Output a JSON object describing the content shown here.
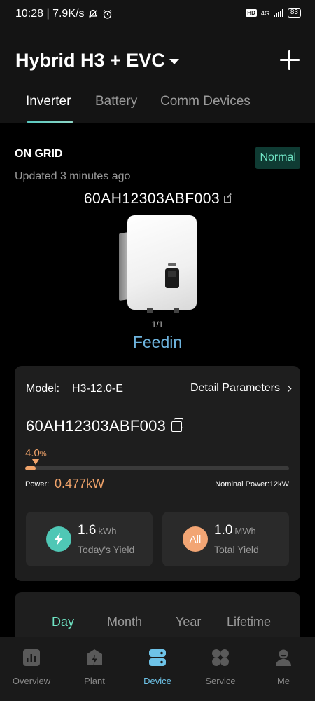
{
  "status_bar": {
    "time_speed": "10:28 | 7.9K/s",
    "network": "4G",
    "hd_badge": "HD",
    "battery": "83"
  },
  "header": {
    "title": "Hybrid H3 + EVC",
    "tabs": [
      {
        "label": "Inverter",
        "active": true
      },
      {
        "label": "Battery",
        "active": false
      },
      {
        "label": "Comm Devices",
        "active": false
      }
    ]
  },
  "device": {
    "grid_status": "ON GRID",
    "updated": "Updated 3 minutes ago",
    "status_badge": "Normal",
    "serial": "60AH12303ABF003",
    "pager": "1/1",
    "name": "Feedin"
  },
  "details": {
    "model_label": "Model:",
    "model_value": "H3-12.0-E",
    "detail_link": "Detail Parameters",
    "serial": "60AH12303ABF003",
    "percent_value": "4.0",
    "percent_unit": "%",
    "progress_fraction": 0.04,
    "power_label": "Power:",
    "power_value": "0.477kW",
    "nominal_power": "Nominal Power:12kW",
    "today": {
      "value": "1.6",
      "unit": "kWh",
      "label": "Today's Yield"
    },
    "total": {
      "value": "1.0",
      "unit": "MWh",
      "label": "Total Yield",
      "icon_text": "All"
    }
  },
  "range_tabs": [
    {
      "label": "Day",
      "active": true
    },
    {
      "label": "Month",
      "active": false
    },
    {
      "label": "Year",
      "active": false
    },
    {
      "label": "Lifetime",
      "active": false
    }
  ],
  "bottom_nav": [
    {
      "label": "Overview",
      "icon": "chart-icon",
      "active": false
    },
    {
      "label": "Plant",
      "icon": "plant-icon",
      "active": false
    },
    {
      "label": "Device",
      "icon": "device-icon",
      "active": true
    },
    {
      "label": "Service",
      "icon": "service-icon",
      "active": false
    },
    {
      "label": "Me",
      "icon": "profile-icon",
      "active": false
    }
  ],
  "colors": {
    "accent_teal": "#6fe3c3",
    "accent_orange": "#f0a36a",
    "feedin_blue": "#6eb4de",
    "nav_active": "#6ec3e8"
  }
}
